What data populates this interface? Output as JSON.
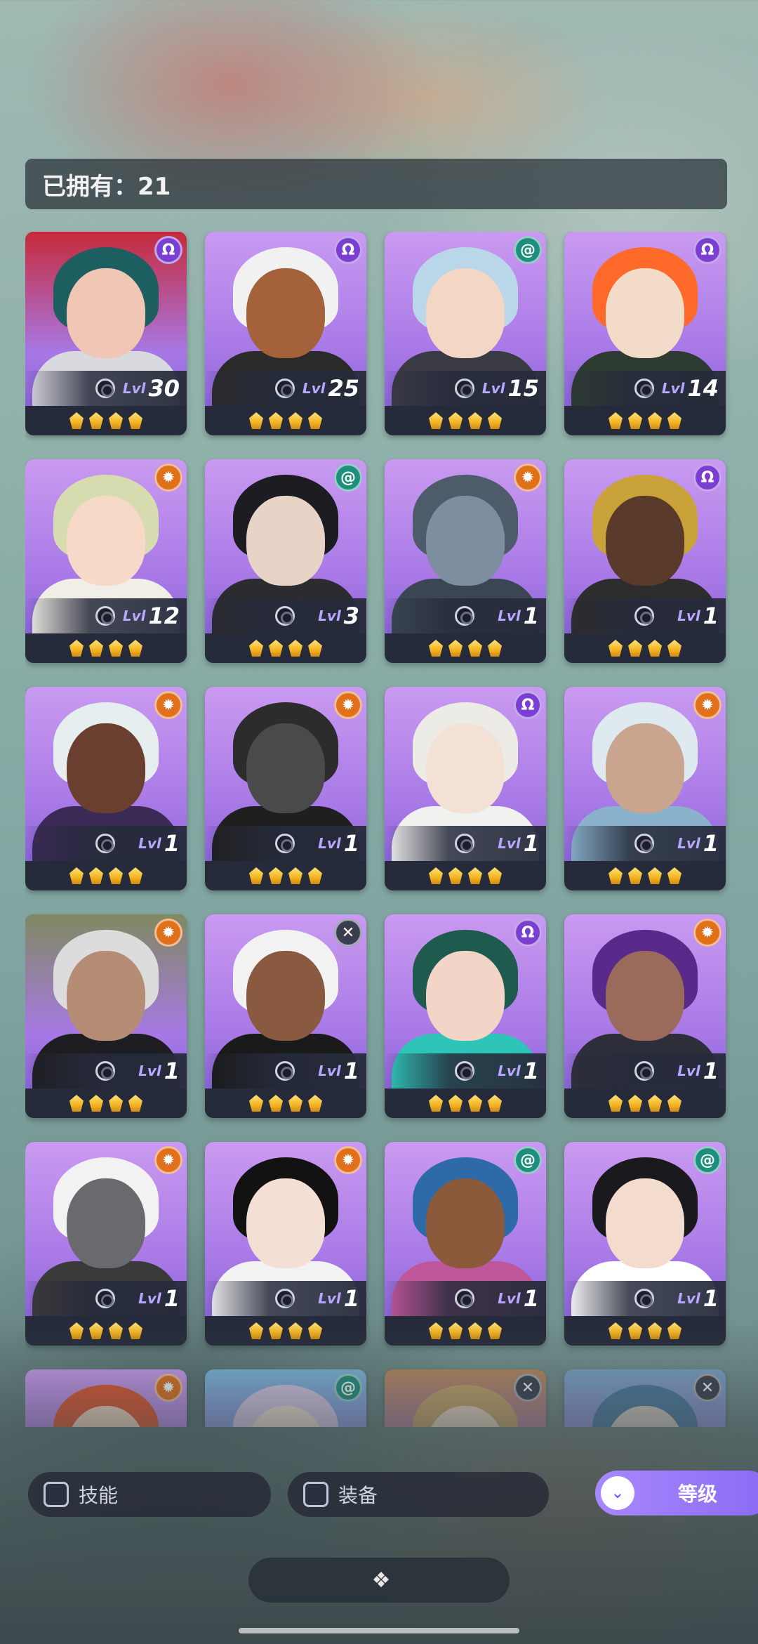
{
  "owned": {
    "label": "已拥有：21"
  },
  "level_label": "Lvl",
  "heroes": [
    {
      "level": "30",
      "faction_icon": "omega-icon",
      "faction_color": "#7a3fd0",
      "hair": "#1d5f60",
      "skin": "#f0c7b4",
      "body": "#d9d9e0",
      "bg": "#c62a3a"
    },
    {
      "level": "25",
      "faction_icon": "omega-icon",
      "faction_color": "#7a3fd0",
      "hair": "#f1f1f1",
      "skin": "#a3623a",
      "body": "#2a2a2a",
      "bg": "#c79af2"
    },
    {
      "level": "15",
      "faction_icon": "swirl-icon",
      "faction_color": "#1d8f7f",
      "hair": "#b9d7e8",
      "skin": "#f3d6c4",
      "body": "#3a3a44",
      "bg": "#c99af0"
    },
    {
      "level": "14",
      "faction_icon": "omega-icon",
      "faction_color": "#7a3fd0",
      "hair": "#ff6a2a",
      "skin": "#f2dcc9",
      "body": "#2e3b32",
      "bg": "#c99af0"
    },
    {
      "level": "12",
      "faction_icon": "sun-icon",
      "faction_color": "#e0701a",
      "hair": "#d6dcb0",
      "skin": "#f6d9c7",
      "body": "#f0eee6",
      "bg": "#c99af0"
    },
    {
      "level": "3",
      "faction_icon": "swirl-icon",
      "faction_color": "#1d8f7f",
      "hair": "#1c1c22",
      "skin": "#e7d4c6",
      "body": "#2b2b30",
      "bg": "#c99af0"
    },
    {
      "level": "1",
      "faction_icon": "sun-icon",
      "faction_color": "#e0701a",
      "hair": "#4d5b6b",
      "skin": "#7d8ea0",
      "body": "#3b4654",
      "bg": "#c99af0"
    },
    {
      "level": "1",
      "faction_icon": "omega-icon",
      "faction_color": "#7a3fd0",
      "hair": "#c9a23a",
      "skin": "#5a3a2a",
      "body": "#2d2d2d",
      "bg": "#c99af0"
    },
    {
      "level": "1",
      "faction_icon": "sun-icon",
      "faction_color": "#e0701a",
      "hair": "#e6eef0",
      "skin": "#6b3f2f",
      "body": "#3a2a55",
      "bg": "#c99af0"
    },
    {
      "level": "1",
      "faction_icon": "sun-icon",
      "faction_color": "#e0701a",
      "hair": "#2c2c2c",
      "skin": "#4a4a4a",
      "body": "#1f1f1f",
      "bg": "#c99af0"
    },
    {
      "level": "1",
      "faction_icon": "omega-icon",
      "faction_color": "#7a3fd0",
      "hair": "#ecebe6",
      "skin": "#f3e1d6",
      "body": "#f1f1ef",
      "bg": "#c99af0"
    },
    {
      "level": "1",
      "faction_icon": "sun-icon",
      "faction_color": "#e0701a",
      "hair": "#dfe9f0",
      "skin": "#c9a48f",
      "body": "#8ab2cc",
      "bg": "#c99af0"
    },
    {
      "level": "1",
      "faction_icon": "sun-icon",
      "faction_color": "#e0701a",
      "hair": "#dcdcdc",
      "skin": "#b58c74",
      "body": "#1e1e22",
      "bg": "#7f8a60"
    },
    {
      "level": "1",
      "faction_icon": "cross-icon",
      "faction_color": "#3a3f4f",
      "hair": "#f2f2f2",
      "skin": "#8a5a40",
      "body": "#1a1a1a",
      "bg": "#c99af0"
    },
    {
      "level": "1",
      "faction_icon": "omega-icon",
      "faction_color": "#7a3fd0",
      "hair": "#1f5a4f",
      "skin": "#f2d5c7",
      "body": "#2fc4b8",
      "bg": "#c99af0"
    },
    {
      "level": "1",
      "faction_icon": "sun-icon",
      "faction_color": "#e0701a",
      "hair": "#5a2a8a",
      "skin": "#9a6a5a",
      "body": "#2e2e3a",
      "bg": "#c99af0"
    },
    {
      "level": "1",
      "faction_icon": "sun-icon",
      "faction_color": "#e0701a",
      "hair": "#f2f2f2",
      "skin": "#6a6a6e",
      "body": "#3a3a3a",
      "bg": "#c99af0"
    },
    {
      "level": "1",
      "faction_icon": "sun-icon",
      "faction_color": "#e0701a",
      "hair": "#121212",
      "skin": "#f4dfd4",
      "body": "#f2f2f2",
      "bg": "#c99af0"
    },
    {
      "level": "1",
      "faction_icon": "swirl-icon",
      "faction_color": "#1d8f7f",
      "hair": "#2e6aa8",
      "skin": "#8a5a3a",
      "body": "#c0569a",
      "bg": "#c99af0"
    },
    {
      "level": "1",
      "faction_icon": "swirl-icon",
      "faction_color": "#1d8f7f",
      "hair": "#1a1a1e",
      "skin": "#f3dbce",
      "body": "#ffffff",
      "bg": "#c99af0"
    },
    {
      "level": "",
      "faction_icon": "sun-icon",
      "faction_color": "#e0701a",
      "hair": "#e2542e",
      "skin": "#f2d5c0",
      "body": "#c99af0",
      "bg": "#c99af0"
    },
    {
      "level": "",
      "faction_icon": "swirl-icon",
      "faction_color": "#1d8f7f",
      "hair": "#d6c8e8",
      "skin": "#f2e0d6",
      "body": "#7ab9e0",
      "bg": "#7ab9e0"
    },
    {
      "level": "",
      "faction_icon": "cross-icon",
      "faction_color": "#3a3f4f",
      "hair": "#c7a36a",
      "skin": "#e8d4c0",
      "body": "#6a4a30",
      "bg": "#b8885a"
    },
    {
      "level": "",
      "faction_icon": "cross-icon",
      "faction_color": "#3a3f4f",
      "hair": "#4a7aa0",
      "skin": "#d0c8c0",
      "body": "#5a7a94",
      "bg": "#7aa4c8"
    }
  ],
  "filters": {
    "skill": "技能",
    "equipment": "装备"
  },
  "sort": {
    "label": "等级",
    "icon": "chevrons-down-icon"
  },
  "collapse": {
    "icon": "diamond-cluster-icon",
    "glyph": "❖"
  }
}
